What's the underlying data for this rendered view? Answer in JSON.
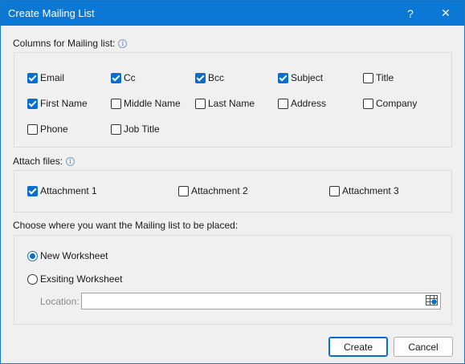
{
  "window": {
    "title": "Create Mailing List",
    "help_label": "?",
    "close_label": "✕"
  },
  "columns_section": {
    "label": "Columns for Mailing list:",
    "info_icon": "info-icon",
    "items": [
      {
        "label": "Email",
        "checked": true
      },
      {
        "label": "Cc",
        "checked": true
      },
      {
        "label": "Bcc",
        "checked": true
      },
      {
        "label": "Subject",
        "checked": true
      },
      {
        "label": "Title",
        "checked": false
      },
      {
        "label": "First Name",
        "checked": true
      },
      {
        "label": "Middle Name",
        "checked": false
      },
      {
        "label": "Last Name",
        "checked": false
      },
      {
        "label": "Address",
        "checked": false
      },
      {
        "label": "Company",
        "checked": false
      },
      {
        "label": "Phone",
        "checked": false
      },
      {
        "label": "Job Title",
        "checked": false
      }
    ]
  },
  "attach_section": {
    "label": "Attach files:",
    "items": [
      {
        "label": "Attachment 1",
        "checked": true
      },
      {
        "label": "Attachment 2",
        "checked": false
      },
      {
        "label": "Attachment 3",
        "checked": false
      }
    ]
  },
  "placement_section": {
    "label": "Choose where you want the Mailing list to be placed:",
    "options": [
      {
        "label": "New Worksheet",
        "selected": true
      },
      {
        "label": "Exsiting Worksheet",
        "selected": false
      }
    ],
    "location_label": "Location:",
    "location_value": ""
  },
  "buttons": {
    "create": "Create",
    "cancel": "Cancel"
  },
  "colors": {
    "accent": "#0a78d4",
    "check": "#0a6ed1"
  }
}
